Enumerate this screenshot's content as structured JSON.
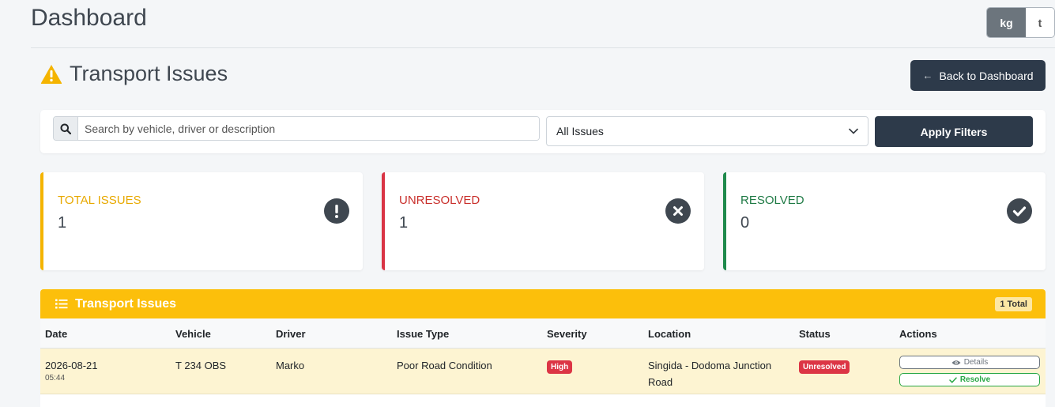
{
  "header": {
    "title": "Dashboard"
  },
  "unit_toggle": {
    "options": [
      "kg",
      "t"
    ],
    "selected": "kg"
  },
  "section": {
    "title": "Transport Issues",
    "back_button": "Back to Dashboard"
  },
  "filters": {
    "search_placeholder": "Search by vehicle, driver or description",
    "select_value": "All Issues",
    "apply_label": "Apply Filters"
  },
  "stats": {
    "total": {
      "label": "TOTAL ISSUES",
      "value": "1"
    },
    "unresolved": {
      "label": "UNRESOLVED",
      "value": "1"
    },
    "resolved": {
      "label": "RESOLVED",
      "value": "0"
    }
  },
  "table": {
    "title": "Transport Issues",
    "total_badge": "1 Total",
    "columns": [
      "Date",
      "Vehicle",
      "Driver",
      "Issue Type",
      "Severity",
      "Location",
      "Status",
      "Actions"
    ],
    "rows": [
      {
        "date": "2026-08-21",
        "time": "05:44",
        "vehicle": "T 234 OBS",
        "driver": "Marko",
        "issue_type": "Poor Road Condition",
        "severity": "High",
        "location": "Singida - Dodoma Junction Road",
        "status": "Unresolved",
        "details_label": "Details",
        "resolve_label": "Resolve"
      }
    ]
  },
  "colors": {
    "accent_dark": "#2d3a4a",
    "warning": "#fcbf0b",
    "danger": "#dc3545",
    "success": "#28a745"
  },
  "icons": {
    "section": "warning-triangle-icon",
    "search": "search-icon",
    "select": "chevron-down-icon",
    "back": "arrow-left-icon",
    "total": "exclamation-circle-icon",
    "unresolved": "times-circle-icon",
    "resolved": "check-circle-icon",
    "table": "list-icon",
    "details": "eye-icon",
    "resolve": "check-icon"
  }
}
